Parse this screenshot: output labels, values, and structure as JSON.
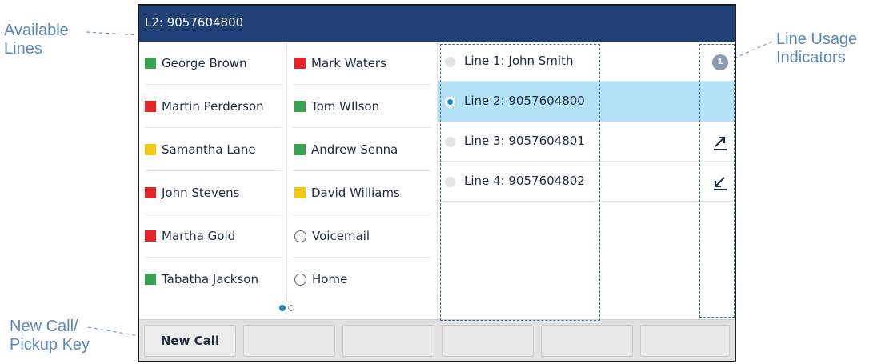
{
  "screen": {
    "title": "L2: 9057604800"
  },
  "colors": {
    "title_bar": "#1e4077",
    "selected_row": "#b3e1f5",
    "presence_green": "#37a451",
    "presence_red": "#e3222a",
    "presence_yellow": "#f2c811",
    "annotation": "#5b86b8"
  },
  "contacts": {
    "left": [
      {
        "name": "George Brown",
        "status": "green"
      },
      {
        "name": "Martin Perderson",
        "status": "red"
      },
      {
        "name": "Samantha Lane",
        "status": "yellow"
      },
      {
        "name": "John Stevens",
        "status": "red"
      },
      {
        "name": "Martha Gold",
        "status": "red"
      },
      {
        "name": "Tabatha Jackson",
        "status": "green"
      }
    ],
    "right": [
      {
        "name": "Mark Waters",
        "status": "red"
      },
      {
        "name": "Tom WIlson",
        "status": "green"
      },
      {
        "name": "Andrew Senna",
        "status": "green"
      },
      {
        "name": "David Williams",
        "status": "yellow"
      },
      {
        "name": "Voicemail",
        "status": "none"
      },
      {
        "name": "Home",
        "status": "none"
      }
    ],
    "page_indicator": {
      "current": 1,
      "total": 2
    }
  },
  "lines": [
    {
      "label": "Line 1: John Smith",
      "selected": false,
      "indicator": "1",
      "indicator_icon": "count-badge-icon"
    },
    {
      "label": "Line 2: 9057604800",
      "selected": true,
      "indicator": "",
      "indicator_icon": ""
    },
    {
      "label": "Line 3: 9057604801",
      "selected": false,
      "indicator": "",
      "indicator_icon": "outgoing-call-icon"
    },
    {
      "label": "Line 4: 9057604802",
      "selected": false,
      "indicator": "",
      "indicator_icon": "incoming-call-icon"
    }
  ],
  "softkeys": [
    "New Call",
    "",
    "",
    "",
    "",
    ""
  ],
  "callouts": {
    "available_lines": [
      "Available",
      "Lines"
    ],
    "line_usage_indicators": [
      "Line Usage",
      "Indicators"
    ],
    "new_call_pickup_key": [
      "New Call/",
      "Pickup Key"
    ]
  }
}
